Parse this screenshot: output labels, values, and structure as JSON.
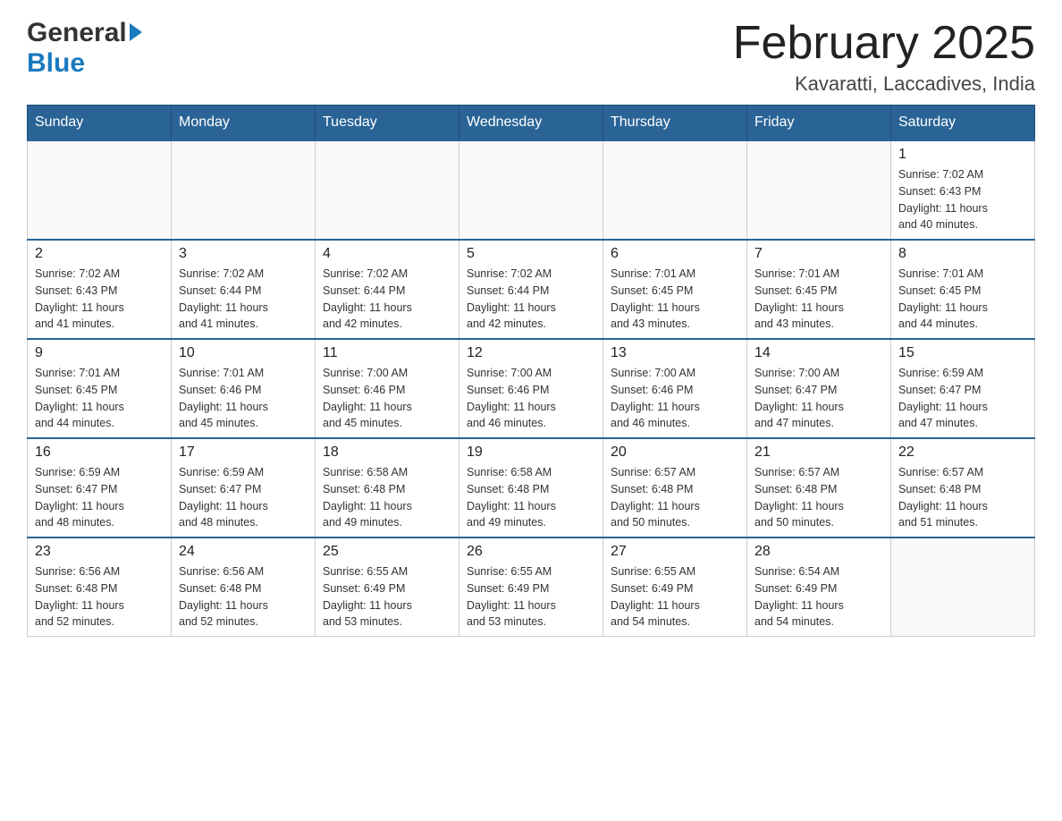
{
  "header": {
    "logo_general": "General",
    "logo_blue": "Blue",
    "title": "February 2025",
    "subtitle": "Kavaratti, Laccadives, India"
  },
  "days_of_week": [
    "Sunday",
    "Monday",
    "Tuesday",
    "Wednesday",
    "Thursday",
    "Friday",
    "Saturday"
  ],
  "weeks": [
    [
      {
        "day": "",
        "info": ""
      },
      {
        "day": "",
        "info": ""
      },
      {
        "day": "",
        "info": ""
      },
      {
        "day": "",
        "info": ""
      },
      {
        "day": "",
        "info": ""
      },
      {
        "day": "",
        "info": ""
      },
      {
        "day": "1",
        "info": "Sunrise: 7:02 AM\nSunset: 6:43 PM\nDaylight: 11 hours\nand 40 minutes."
      }
    ],
    [
      {
        "day": "2",
        "info": "Sunrise: 7:02 AM\nSunset: 6:43 PM\nDaylight: 11 hours\nand 41 minutes."
      },
      {
        "day": "3",
        "info": "Sunrise: 7:02 AM\nSunset: 6:44 PM\nDaylight: 11 hours\nand 41 minutes."
      },
      {
        "day": "4",
        "info": "Sunrise: 7:02 AM\nSunset: 6:44 PM\nDaylight: 11 hours\nand 42 minutes."
      },
      {
        "day": "5",
        "info": "Sunrise: 7:02 AM\nSunset: 6:44 PM\nDaylight: 11 hours\nand 42 minutes."
      },
      {
        "day": "6",
        "info": "Sunrise: 7:01 AM\nSunset: 6:45 PM\nDaylight: 11 hours\nand 43 minutes."
      },
      {
        "day": "7",
        "info": "Sunrise: 7:01 AM\nSunset: 6:45 PM\nDaylight: 11 hours\nand 43 minutes."
      },
      {
        "day": "8",
        "info": "Sunrise: 7:01 AM\nSunset: 6:45 PM\nDaylight: 11 hours\nand 44 minutes."
      }
    ],
    [
      {
        "day": "9",
        "info": "Sunrise: 7:01 AM\nSunset: 6:45 PM\nDaylight: 11 hours\nand 44 minutes."
      },
      {
        "day": "10",
        "info": "Sunrise: 7:01 AM\nSunset: 6:46 PM\nDaylight: 11 hours\nand 45 minutes."
      },
      {
        "day": "11",
        "info": "Sunrise: 7:00 AM\nSunset: 6:46 PM\nDaylight: 11 hours\nand 45 minutes."
      },
      {
        "day": "12",
        "info": "Sunrise: 7:00 AM\nSunset: 6:46 PM\nDaylight: 11 hours\nand 46 minutes."
      },
      {
        "day": "13",
        "info": "Sunrise: 7:00 AM\nSunset: 6:46 PM\nDaylight: 11 hours\nand 46 minutes."
      },
      {
        "day": "14",
        "info": "Sunrise: 7:00 AM\nSunset: 6:47 PM\nDaylight: 11 hours\nand 47 minutes."
      },
      {
        "day": "15",
        "info": "Sunrise: 6:59 AM\nSunset: 6:47 PM\nDaylight: 11 hours\nand 47 minutes."
      }
    ],
    [
      {
        "day": "16",
        "info": "Sunrise: 6:59 AM\nSunset: 6:47 PM\nDaylight: 11 hours\nand 48 minutes."
      },
      {
        "day": "17",
        "info": "Sunrise: 6:59 AM\nSunset: 6:47 PM\nDaylight: 11 hours\nand 48 minutes."
      },
      {
        "day": "18",
        "info": "Sunrise: 6:58 AM\nSunset: 6:48 PM\nDaylight: 11 hours\nand 49 minutes."
      },
      {
        "day": "19",
        "info": "Sunrise: 6:58 AM\nSunset: 6:48 PM\nDaylight: 11 hours\nand 49 minutes."
      },
      {
        "day": "20",
        "info": "Sunrise: 6:57 AM\nSunset: 6:48 PM\nDaylight: 11 hours\nand 50 minutes."
      },
      {
        "day": "21",
        "info": "Sunrise: 6:57 AM\nSunset: 6:48 PM\nDaylight: 11 hours\nand 50 minutes."
      },
      {
        "day": "22",
        "info": "Sunrise: 6:57 AM\nSunset: 6:48 PM\nDaylight: 11 hours\nand 51 minutes."
      }
    ],
    [
      {
        "day": "23",
        "info": "Sunrise: 6:56 AM\nSunset: 6:48 PM\nDaylight: 11 hours\nand 52 minutes."
      },
      {
        "day": "24",
        "info": "Sunrise: 6:56 AM\nSunset: 6:48 PM\nDaylight: 11 hours\nand 52 minutes."
      },
      {
        "day": "25",
        "info": "Sunrise: 6:55 AM\nSunset: 6:49 PM\nDaylight: 11 hours\nand 53 minutes."
      },
      {
        "day": "26",
        "info": "Sunrise: 6:55 AM\nSunset: 6:49 PM\nDaylight: 11 hours\nand 53 minutes."
      },
      {
        "day": "27",
        "info": "Sunrise: 6:55 AM\nSunset: 6:49 PM\nDaylight: 11 hours\nand 54 minutes."
      },
      {
        "day": "28",
        "info": "Sunrise: 6:54 AM\nSunset: 6:49 PM\nDaylight: 11 hours\nand 54 minutes."
      },
      {
        "day": "",
        "info": ""
      }
    ]
  ]
}
